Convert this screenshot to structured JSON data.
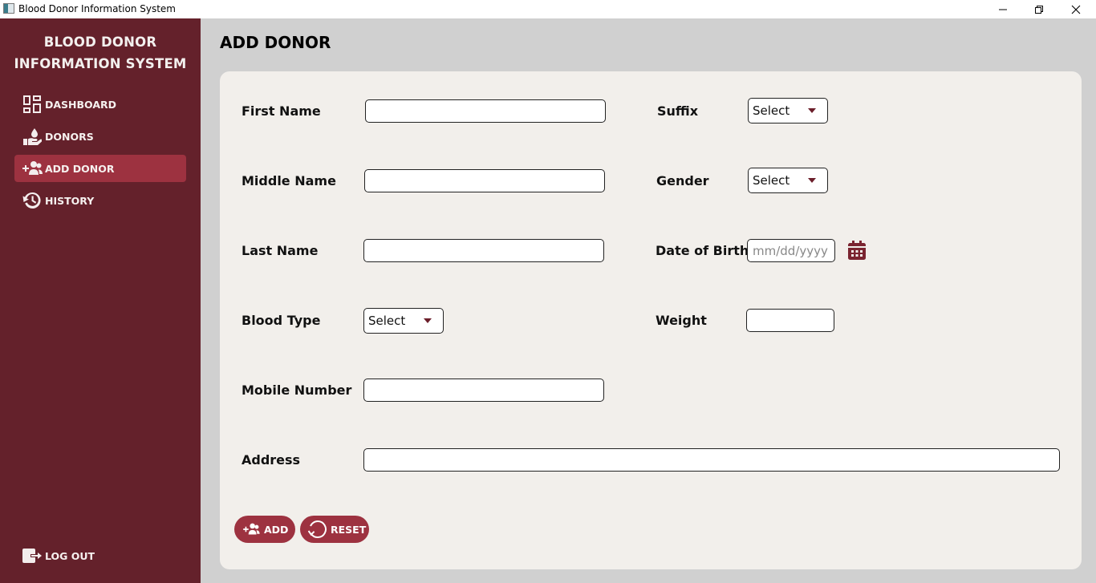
{
  "window": {
    "title": "Blood Donor Information System",
    "controls": {
      "minimize": "—",
      "maximize": "❐",
      "close": "✕"
    }
  },
  "sidebar": {
    "brand_line1": "BLOOD DONOR",
    "brand_line2": "INFORMATION SYSTEM",
    "items": [
      {
        "label": "DASHBOARD",
        "icon": "dashboard-icon",
        "active": false
      },
      {
        "label": "DONORS",
        "icon": "blood-drop-hand-icon",
        "active": false
      },
      {
        "label": "ADD DONOR",
        "icon": "user-plus-icon",
        "active": true
      },
      {
        "label": "HISTORY",
        "icon": "history-icon",
        "active": false
      }
    ],
    "logout_label": "LOG OUT"
  },
  "page": {
    "title": "ADD DONOR"
  },
  "form": {
    "first_name": {
      "label": "First Name",
      "value": ""
    },
    "middle_name": {
      "label": "Middle Name",
      "value": ""
    },
    "last_name": {
      "label": "Last Name",
      "value": ""
    },
    "blood_type": {
      "label": "Blood Type",
      "selected": "Select"
    },
    "mobile_number": {
      "label": "Mobile Number",
      "value": ""
    },
    "address": {
      "label": "Address",
      "value": ""
    },
    "suffix": {
      "label": "Suffix",
      "selected": "Select"
    },
    "gender": {
      "label": "Gender",
      "selected": "Select"
    },
    "date_of_birth": {
      "label": "Date of Birth",
      "value": "",
      "placeholder": "mm/dd/yyyy"
    },
    "weight": {
      "label": "Weight",
      "value": ""
    },
    "add_label": "ADD",
    "reset_label": "RESET"
  },
  "colors": {
    "sidebar_bg": "#64212b",
    "accent": "#9d3240",
    "main_bg": "#d0d0d0",
    "card_bg": "#f2efeb"
  }
}
